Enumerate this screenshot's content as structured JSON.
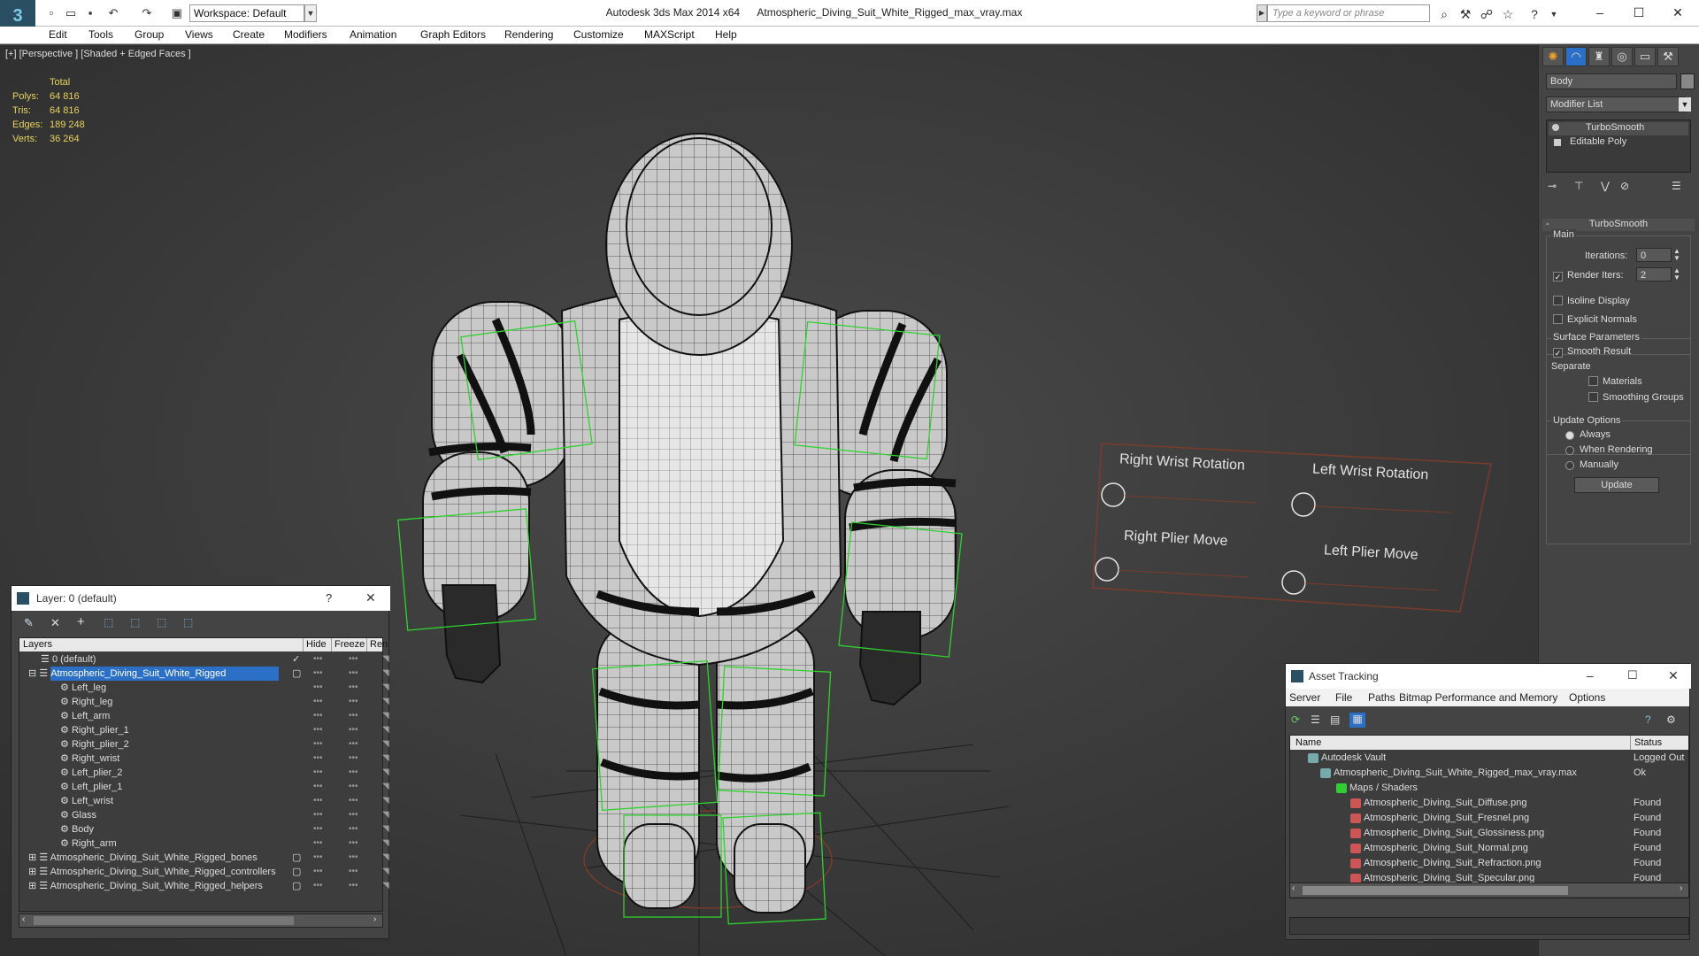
{
  "titlebar": {
    "app_title": "Autodesk 3ds Max  2014 x64",
    "file_title": "Atmospheric_Diving_Suit_White_Rigged_max_vray.max",
    "workspace_label": "Workspace: Default",
    "search_placeholder": "Type a keyword or phrase"
  },
  "menubar": {
    "items": [
      "Edit",
      "Tools",
      "Group",
      "Views",
      "Create",
      "Modifiers",
      "Animation",
      "Graph Editors",
      "Rendering",
      "Customize",
      "MAXScript",
      "Help"
    ]
  },
  "viewport": {
    "label": "[+] [Perspective ] [Shaded + Edged Faces ]",
    "stats": {
      "header": "Total",
      "polys_label": "Polys:",
      "polys": "64 816",
      "tris_label": "Tris:",
      "tris": "64 816",
      "edges_label": "Edges:",
      "edges": "189 248",
      "verts_label": "Verts:",
      "verts": "36 264"
    },
    "controls": {
      "right_wrist": "Right Wrist Rotation",
      "left_wrist": "Left Wrist Rotation",
      "right_plier": "Right Plier Move",
      "left_plier": "Left Plier Move"
    }
  },
  "command_panel": {
    "object_name": "Body",
    "modifier_list": "Modifier List",
    "stack": [
      "TurboSmooth",
      "Editable Poly"
    ],
    "rollout_title": "TurboSmooth",
    "main_label": "Main",
    "iterations_label": "Iterations:",
    "iterations_value": "0",
    "render_iters_label": "Render Iters:",
    "render_iters_value": "2",
    "isoline_label": "Isoline Display",
    "explicit_normals_label": "Explicit Normals",
    "surface_params_label": "Surface Parameters",
    "smooth_result_label": "Smooth Result",
    "separate_label": "Separate",
    "materials_label": "Materials",
    "smoothing_groups_label": "Smoothing Groups",
    "update_options_label": "Update Options",
    "always_label": "Always",
    "when_rendering_label": "When Rendering",
    "manually_label": "Manually",
    "update_button": "Update"
  },
  "layer_panel": {
    "title": "Layer: 0 (default)",
    "help": "?",
    "col_layers": "Layers",
    "col_hide": "Hide",
    "col_freeze": "Freeze",
    "col_render": "Ren",
    "rows": [
      {
        "name": "0 (default)",
        "indent": 1
      },
      {
        "name": "Atmospheric_Diving_Suit_White_Rigged",
        "indent": 1
      },
      {
        "name": "Left_leg",
        "indent": 2
      },
      {
        "name": "Right_leg",
        "indent": 2
      },
      {
        "name": "Left_arm",
        "indent": 2
      },
      {
        "name": "Right_plier_1",
        "indent": 2
      },
      {
        "name": "Right_plier_2",
        "indent": 2
      },
      {
        "name": "Right_wrist",
        "indent": 2
      },
      {
        "name": "Left_plier_2",
        "indent": 2
      },
      {
        "name": "Left_plier_1",
        "indent": 2
      },
      {
        "name": "Left_wrist",
        "indent": 2
      },
      {
        "name": "Glass",
        "indent": 2
      },
      {
        "name": "Body",
        "indent": 2
      },
      {
        "name": "Right_arm",
        "indent": 2
      },
      {
        "name": "Atmospheric_Diving_Suit_White_Rigged_bones",
        "indent": 1
      },
      {
        "name": "Atmospheric_Diving_Suit_White_Rigged_controllers",
        "indent": 1
      },
      {
        "name": "Atmospheric_Diving_Suit_White_Rigged_helpers",
        "indent": 1
      }
    ]
  },
  "asset_panel": {
    "title": "Asset Tracking",
    "menus": [
      "Server",
      "File",
      "Paths",
      "Bitmap Performance and Memory",
      "Options"
    ],
    "col_name": "Name",
    "col_status": "Status",
    "rows": [
      {
        "name": "Autodesk Vault",
        "status": "Logged Out",
        "indent": 1
      },
      {
        "name": "Atmospheric_Diving_Suit_White_Rigged_max_vray.max",
        "status": "Ok",
        "indent": 2
      },
      {
        "name": "Maps / Shaders",
        "status": "",
        "indent": 3
      },
      {
        "name": "Atmospheric_Diving_Suit_Diffuse.png",
        "status": "Found",
        "indent": 4
      },
      {
        "name": "Atmospheric_Diving_Suit_Fresnel.png",
        "status": "Found",
        "indent": 4
      },
      {
        "name": "Atmospheric_Diving_Suit_Glossiness.png",
        "status": "Found",
        "indent": 4
      },
      {
        "name": "Atmospheric_Diving_Suit_Normal.png",
        "status": "Found",
        "indent": 4
      },
      {
        "name": "Atmospheric_Diving_Suit_Refraction.png",
        "status": "Found",
        "indent": 4
      },
      {
        "name": "Atmospheric_Diving_Suit_Specular.png",
        "status": "Found",
        "indent": 4
      }
    ]
  },
  "colors": {
    "selection": "#2c6fc6",
    "stats_text": "#e7d35f",
    "helper_box": "#2fd12f"
  }
}
